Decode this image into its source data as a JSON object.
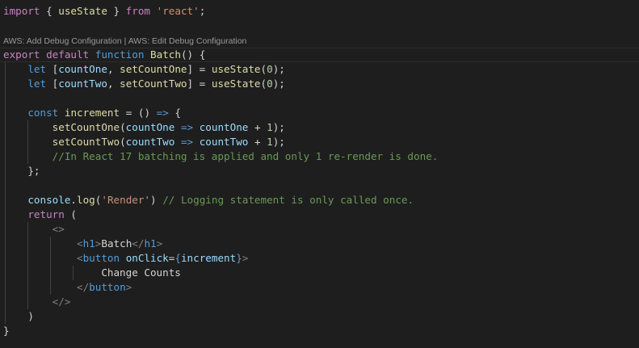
{
  "codelens": {
    "add_label": "AWS: Add Debug Configuration",
    "separator": " | ",
    "edit_label": "AWS: Edit Debug Configuration"
  },
  "colors": {
    "background": "#1e1e1e",
    "keyword_control": "#c586c0",
    "keyword_storage": "#569cd6",
    "function": "#dcdcaa",
    "variable": "#9cdcfe",
    "string": "#ce9178",
    "number": "#b5cea8",
    "comment": "#6a9955"
  },
  "lines": [
    {
      "tokens": [
        {
          "t": "kw",
          "v": "import"
        },
        {
          "t": "pl",
          "v": " { "
        },
        {
          "t": "fn",
          "v": "useState"
        },
        {
          "t": "pl",
          "v": " } "
        },
        {
          "t": "kw",
          "v": "from"
        },
        {
          "t": "pl",
          "v": " "
        },
        {
          "t": "str",
          "v": "'react'"
        },
        {
          "t": "pl",
          "v": ";"
        }
      ]
    },
    {
      "tokens": [
        {
          "t": "kw",
          "v": "export"
        },
        {
          "t": "pl",
          "v": " "
        },
        {
          "t": "kw",
          "v": "default"
        },
        {
          "t": "pl",
          "v": " "
        },
        {
          "t": "st",
          "v": "function"
        },
        {
          "t": "pl",
          "v": " "
        },
        {
          "t": "fn",
          "v": "Batch"
        },
        {
          "t": "pl",
          "v": "() {"
        }
      ]
    },
    {
      "tokens": [
        {
          "t": "pl",
          "v": "    "
        },
        {
          "t": "st",
          "v": "let"
        },
        {
          "t": "pl",
          "v": " ["
        },
        {
          "t": "var",
          "v": "countOne"
        },
        {
          "t": "pl",
          "v": ", "
        },
        {
          "t": "fn",
          "v": "setCountOne"
        },
        {
          "t": "pl",
          "v": "] = "
        },
        {
          "t": "fn",
          "v": "useState"
        },
        {
          "t": "pl",
          "v": "("
        },
        {
          "t": "num",
          "v": "0"
        },
        {
          "t": "pl",
          "v": ");"
        }
      ]
    },
    {
      "tokens": [
        {
          "t": "pl",
          "v": "    "
        },
        {
          "t": "st",
          "v": "let"
        },
        {
          "t": "pl",
          "v": " ["
        },
        {
          "t": "var",
          "v": "countTwo"
        },
        {
          "t": "pl",
          "v": ", "
        },
        {
          "t": "fn",
          "v": "setCountTwo"
        },
        {
          "t": "pl",
          "v": "] = "
        },
        {
          "t": "fn",
          "v": "useState"
        },
        {
          "t": "pl",
          "v": "("
        },
        {
          "t": "num",
          "v": "0"
        },
        {
          "t": "pl",
          "v": ");"
        }
      ]
    },
    {
      "tokens": []
    },
    {
      "tokens": [
        {
          "t": "pl",
          "v": "    "
        },
        {
          "t": "st",
          "v": "const"
        },
        {
          "t": "pl",
          "v": " "
        },
        {
          "t": "fn",
          "v": "increment"
        },
        {
          "t": "pl",
          "v": " = () "
        },
        {
          "t": "st",
          "v": "=>"
        },
        {
          "t": "pl",
          "v": " {"
        }
      ]
    },
    {
      "tokens": [
        {
          "t": "pl",
          "v": "        "
        },
        {
          "t": "fn",
          "v": "setCountOne"
        },
        {
          "t": "pl",
          "v": "("
        },
        {
          "t": "var",
          "v": "countOne"
        },
        {
          "t": "pl",
          "v": " "
        },
        {
          "t": "st",
          "v": "=>"
        },
        {
          "t": "pl",
          "v": " "
        },
        {
          "t": "var",
          "v": "countOne"
        },
        {
          "t": "pl",
          "v": " + "
        },
        {
          "t": "num",
          "v": "1"
        },
        {
          "t": "pl",
          "v": ");"
        }
      ]
    },
    {
      "tokens": [
        {
          "t": "pl",
          "v": "        "
        },
        {
          "t": "fn",
          "v": "setCountTwo"
        },
        {
          "t": "pl",
          "v": "("
        },
        {
          "t": "var",
          "v": "countTwo"
        },
        {
          "t": "pl",
          "v": " "
        },
        {
          "t": "st",
          "v": "=>"
        },
        {
          "t": "pl",
          "v": " "
        },
        {
          "t": "var",
          "v": "countTwo"
        },
        {
          "t": "pl",
          "v": " + "
        },
        {
          "t": "num",
          "v": "1"
        },
        {
          "t": "pl",
          "v": ");"
        }
      ]
    },
    {
      "tokens": [
        {
          "t": "pl",
          "v": "        "
        },
        {
          "t": "cm",
          "v": "//In React 17 batching is applied and only 1 re-render is done."
        }
      ]
    },
    {
      "tokens": [
        {
          "t": "pl",
          "v": "    };"
        }
      ]
    },
    {
      "tokens": []
    },
    {
      "tokens": [
        {
          "t": "pl",
          "v": "    "
        },
        {
          "t": "var",
          "v": "console"
        },
        {
          "t": "pl",
          "v": "."
        },
        {
          "t": "fn",
          "v": "log"
        },
        {
          "t": "pl",
          "v": "("
        },
        {
          "t": "str",
          "v": "'Render'"
        },
        {
          "t": "pl",
          "v": ") "
        },
        {
          "t": "cm",
          "v": "// Logging statement is only called once."
        }
      ]
    },
    {
      "tokens": [
        {
          "t": "pl",
          "v": "    "
        },
        {
          "t": "kw",
          "v": "return"
        },
        {
          "t": "pl",
          "v": " ("
        }
      ]
    },
    {
      "tokens": [
        {
          "t": "pl",
          "v": "        "
        },
        {
          "t": "punc",
          "v": "<>"
        }
      ]
    },
    {
      "tokens": [
        {
          "t": "pl",
          "v": "            "
        },
        {
          "t": "punc",
          "v": "<"
        },
        {
          "t": "tag",
          "v": "h1"
        },
        {
          "t": "punc",
          "v": ">"
        },
        {
          "t": "pl",
          "v": "Batch"
        },
        {
          "t": "punc",
          "v": "</"
        },
        {
          "t": "tag",
          "v": "h1"
        },
        {
          "t": "punc",
          "v": ">"
        }
      ]
    },
    {
      "tokens": [
        {
          "t": "pl",
          "v": "            "
        },
        {
          "t": "punc",
          "v": "<"
        },
        {
          "t": "tag",
          "v": "button"
        },
        {
          "t": "pl",
          "v": " "
        },
        {
          "t": "var",
          "v": "onClick"
        },
        {
          "t": "pl",
          "v": "="
        },
        {
          "t": "st",
          "v": "{"
        },
        {
          "t": "var",
          "v": "increment"
        },
        {
          "t": "st",
          "v": "}"
        },
        {
          "t": "punc",
          "v": ">"
        }
      ]
    },
    {
      "tokens": [
        {
          "t": "pl",
          "v": "                Change Counts"
        }
      ]
    },
    {
      "tokens": [
        {
          "t": "pl",
          "v": "            "
        },
        {
          "t": "punc",
          "v": "</"
        },
        {
          "t": "tag",
          "v": "button"
        },
        {
          "t": "punc",
          "v": ">"
        }
      ]
    },
    {
      "tokens": [
        {
          "t": "pl",
          "v": "        "
        },
        {
          "t": "punc",
          "v": "</>"
        }
      ]
    },
    {
      "tokens": [
        {
          "t": "pl",
          "v": "    )"
        }
      ]
    },
    {
      "tokens": [
        {
          "t": "pl",
          "v": "}"
        }
      ]
    }
  ]
}
